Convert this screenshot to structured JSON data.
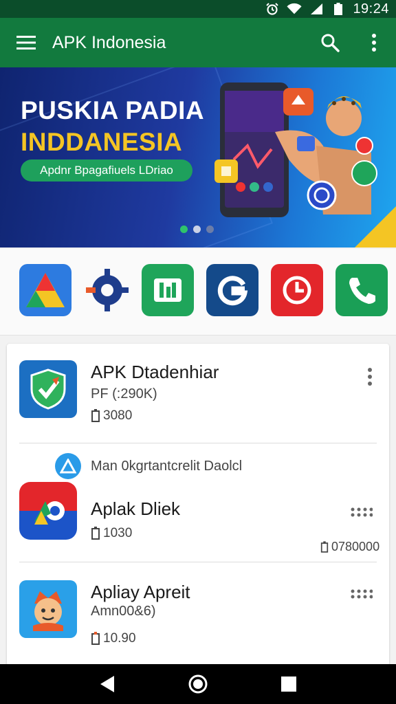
{
  "status_bar": {
    "time": "19:24",
    "icons": [
      "alarm-icon",
      "wifi-icon",
      "signal-icon",
      "battery-icon"
    ]
  },
  "app_bar": {
    "title": "APK Indonesia",
    "menu_icon": "hamburger-menu-icon",
    "search_icon": "search-icon",
    "more_icon": "more-vert-icon"
  },
  "banner": {
    "title_line1": "PUSKIA PADIA",
    "title_line2": "INDDANESIA",
    "pill_label": "Apdnr Bpagafiuels  LDriao",
    "dots": 3,
    "active_dot": 0
  },
  "icon_strip": {
    "icons": [
      {
        "name": "colorful-triangle-app-icon",
        "color": "#2d7be0"
      },
      {
        "name": "gear-app-icon",
        "color": "#1f3d8c"
      },
      {
        "name": "green-book-app-icon",
        "color": "#1fa55a",
        "glyph": "lhl"
      },
      {
        "name": "g-app-icon",
        "color": "#144a8a",
        "glyph": "G"
      },
      {
        "name": "clock-app-icon",
        "color": "#e3262b"
      },
      {
        "name": "phone-app-icon",
        "color": "#1a9f56"
      }
    ]
  },
  "list": {
    "items": [
      {
        "title": "APK Dtadenhiar",
        "subtitle": "PF (:290K)",
        "meta": "3080",
        "icon": "shield-check-app-icon",
        "more_icon": "more-vert-icon"
      },
      {
        "category_label": "Man  0kgrtantcrelit   Daolcl",
        "category_icon": "blue-badge-a-icon",
        "title": "Aplak Dliek",
        "meta": "1030",
        "extra": "0780000",
        "icon": "colorful-play-app-icon",
        "more_icon": "more-dots-icon"
      },
      {
        "title": "Apliay Apreit",
        "subtitle": "Amn00&6)",
        "meta": "10.90",
        "icon": "cartoon-face-app-icon",
        "more_icon": "more-dots-icon"
      }
    ]
  },
  "nav_bar": {
    "back_icon": "back-triangle-icon",
    "home_icon": "home-circle-icon",
    "recents_icon": "recents-square-icon"
  },
  "colors": {
    "app_bar": "#127a3e",
    "status_bar": "#0b4d2a",
    "accent_yellow": "#f4c524",
    "accent_green": "#1ea05c"
  }
}
